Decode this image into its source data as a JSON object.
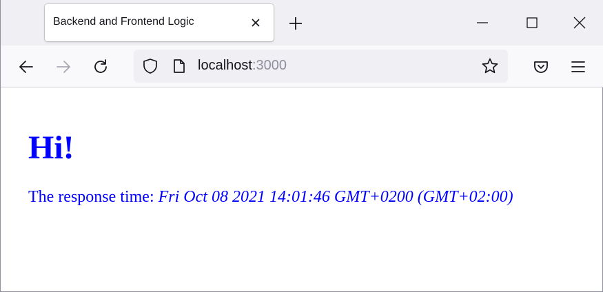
{
  "tab": {
    "title": "Backend and Frontend Logic"
  },
  "urlbar": {
    "host": "localhost",
    "port": ":3000"
  },
  "icons": {
    "tab_close": "close-icon",
    "new_tab": "plus-icon",
    "minimize": "minimize-icon",
    "maximize": "maximize-icon",
    "window_close": "close-icon",
    "back": "arrow-left-icon",
    "forward": "arrow-right-icon",
    "reload": "reload-icon",
    "site_info": "shield-icon",
    "page": "page-icon",
    "bookmark": "star-icon",
    "pocket": "pocket-icon",
    "menu": "hamburger-menu-icon"
  },
  "page": {
    "heading": "Hi!",
    "response_label": "The response time: ",
    "response_value": "Fri Oct 08 2021 14:01:46 GMT+0200 (GMT+02:00)"
  },
  "colors": {
    "content_text": "#0000ff",
    "tabstrip_bg": "#f0f0f4",
    "navbar_bg": "#f9f9fb"
  }
}
